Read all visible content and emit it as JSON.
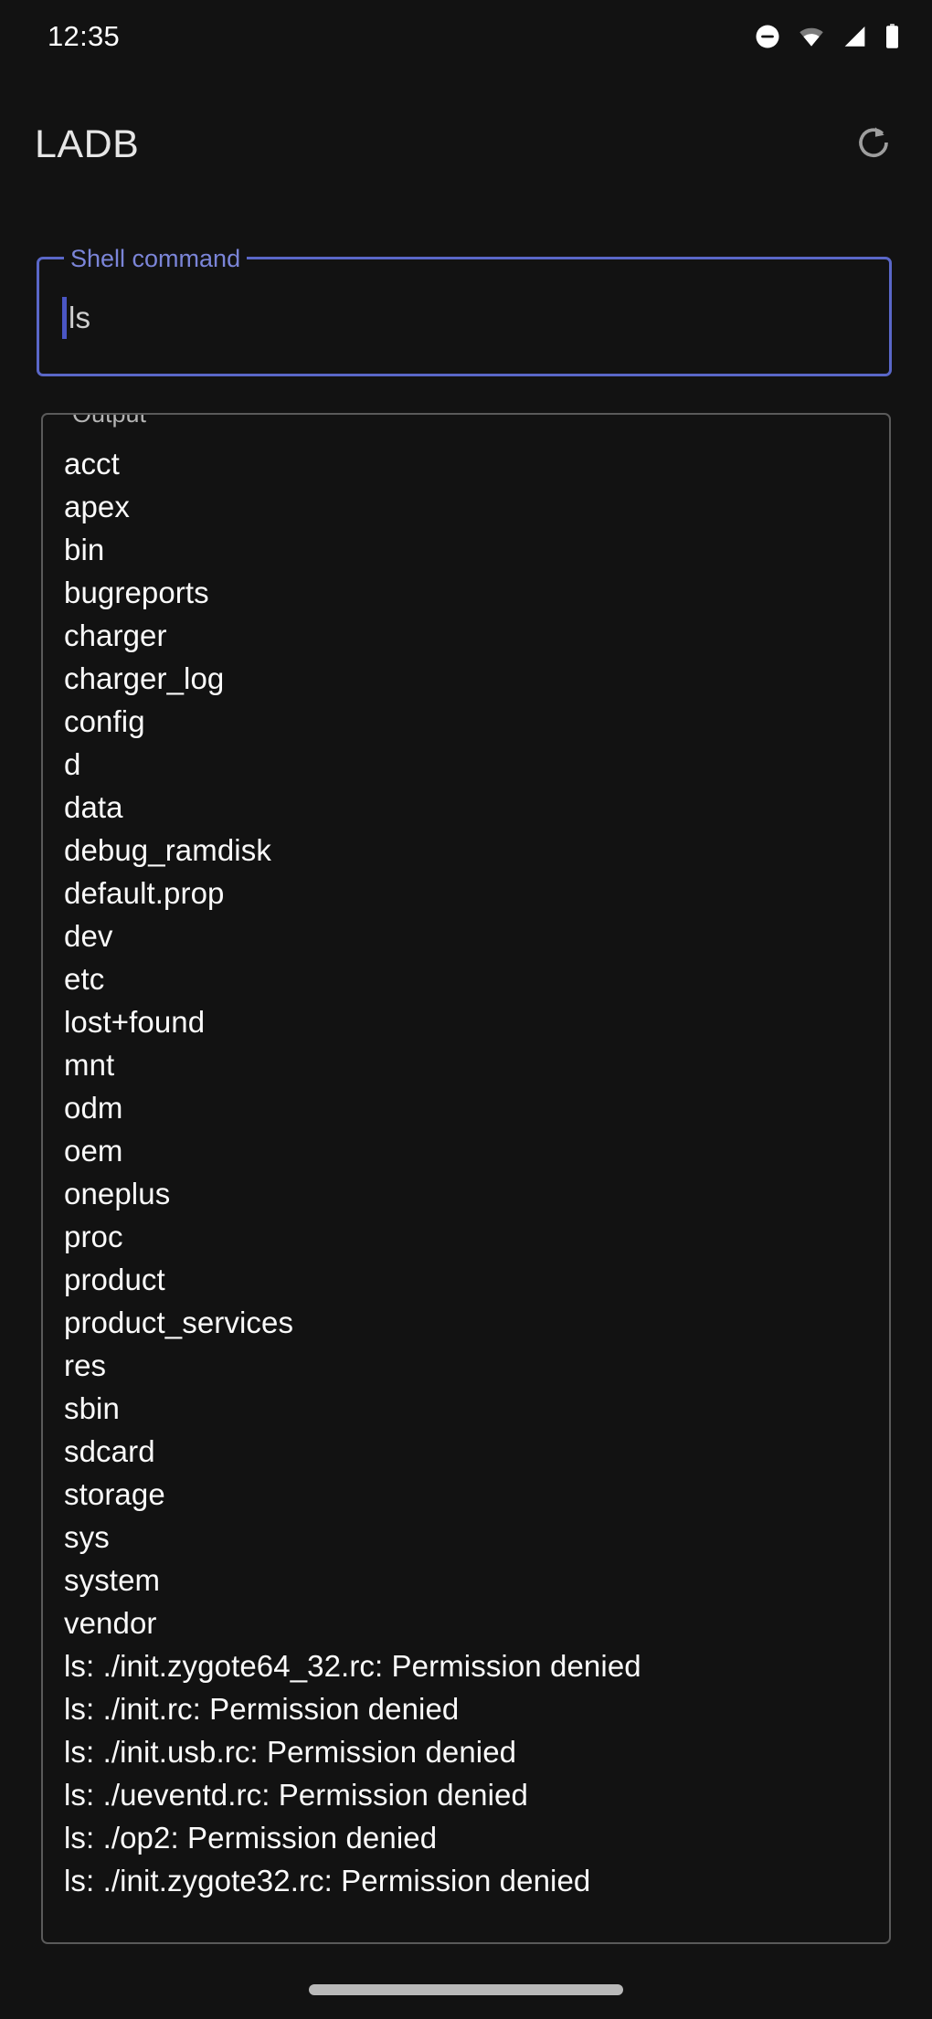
{
  "status_bar": {
    "clock": "12:35",
    "icons": [
      {
        "name": "do-not-disturb-icon",
        "glyph": "dnd"
      },
      {
        "name": "wifi-icon",
        "glyph": "wifi"
      },
      {
        "name": "cellular-signal-icon",
        "glyph": "signal"
      },
      {
        "name": "battery-icon",
        "glyph": "battery"
      }
    ]
  },
  "app_bar": {
    "title": "LADB",
    "refresh_icon": "refresh-icon"
  },
  "command_field": {
    "label": "Shell command",
    "value": "ls",
    "placeholder": "Shell command",
    "accent_color": "#5a67c8",
    "label_color": "#7b85d8",
    "caret_color": "#4a56c4"
  },
  "output_field": {
    "label": "Output",
    "border_color": "#5a5a5a",
    "text_color": "#fafafa",
    "lines": [
      "acct",
      "apex",
      "bin",
      "bugreports",
      "charger",
      "charger_log",
      "config",
      "d",
      "data",
      "debug_ramdisk",
      "default.prop",
      "dev",
      "etc",
      "lost+found",
      "mnt",
      "odm",
      "oem",
      "oneplus",
      "proc",
      "product",
      "product_services",
      "res",
      "sbin",
      "sdcard",
      "storage",
      "sys",
      "system",
      "vendor",
      "ls: ./init.zygote64_32.rc: Permission denied",
      "ls: ./init.rc: Permission denied",
      "ls: ./init.usb.rc: Permission denied",
      "ls: ./ueventd.rc: Permission denied",
      "ls: ./op2: Permission denied",
      "ls: ./init.zygote32.rc: Permission denied"
    ]
  },
  "navigation": {
    "gesture_pill": "home-gesture-pill"
  },
  "theme": {
    "background": "#121212"
  }
}
